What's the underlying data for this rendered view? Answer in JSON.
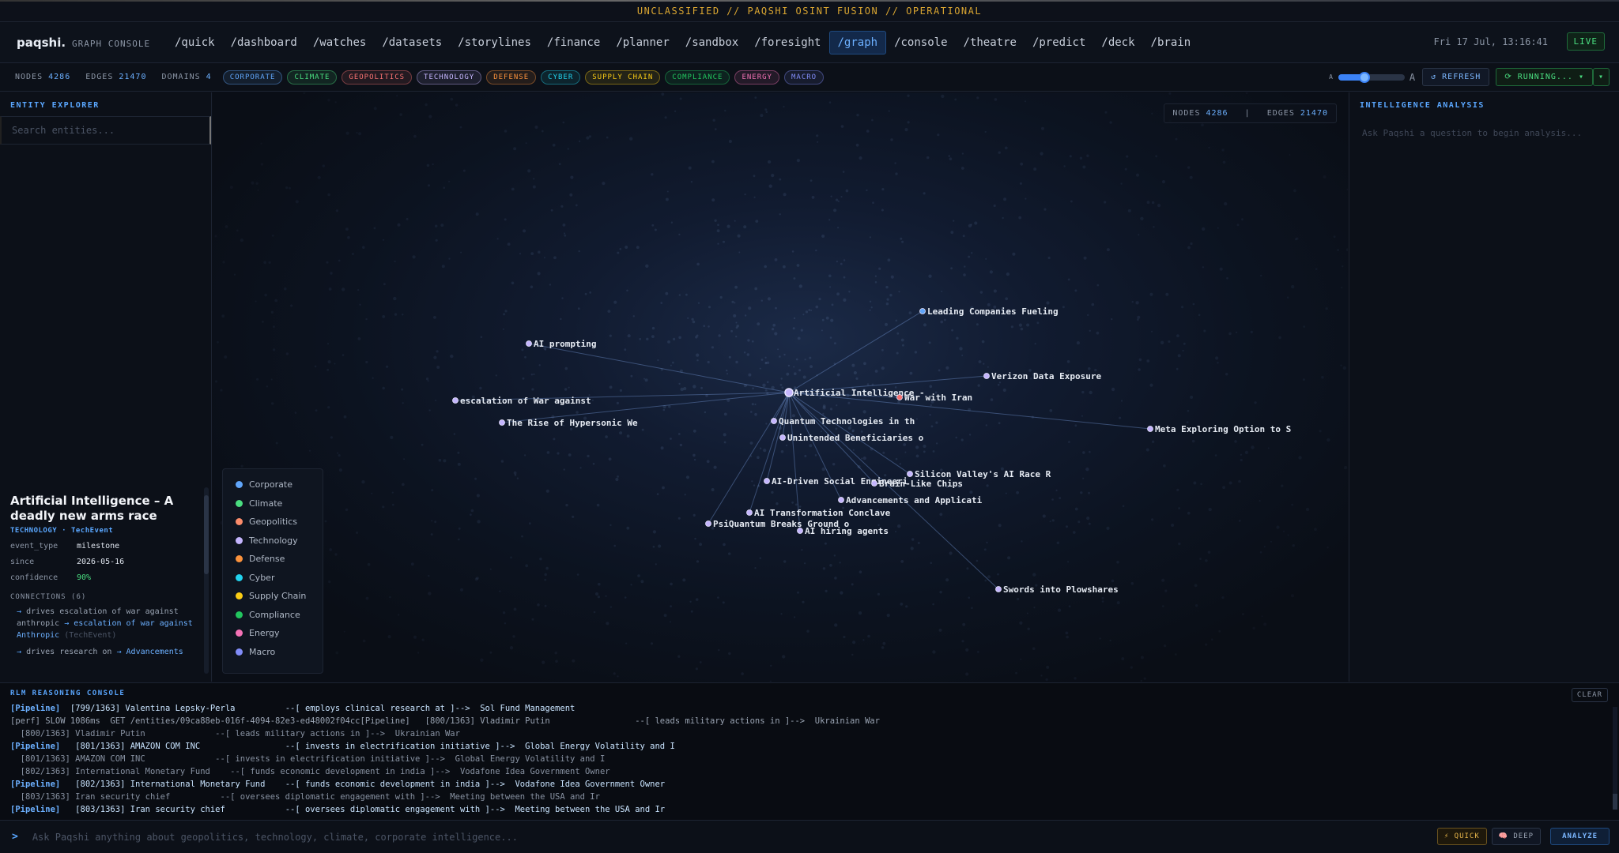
{
  "classification": "UNCLASSIFIED // PAQSHI OSINT FUSION // OPERATIONAL",
  "brand": {
    "logo": "paqshi.",
    "subtitle": "GRAPH CONSOLE"
  },
  "nav": [
    {
      "label": "/quick"
    },
    {
      "label": "/dashboard"
    },
    {
      "label": "/watches"
    },
    {
      "label": "/datasets"
    },
    {
      "label": "/storylines"
    },
    {
      "label": "/finance"
    },
    {
      "label": "/planner"
    },
    {
      "label": "/sandbox"
    },
    {
      "label": "/foresight"
    },
    {
      "label": "/graph",
      "active": true
    },
    {
      "label": "/console"
    },
    {
      "label": "/theatre"
    },
    {
      "label": "/predict"
    },
    {
      "label": "/deck"
    },
    {
      "label": "/brain"
    }
  ],
  "clock": "Fri 17 Jul, 13:16:41",
  "live": "LIVE",
  "stats": {
    "nodes_label": "NODES",
    "nodes": "4286",
    "edges_label": "EDGES",
    "edges": "21470",
    "domains_label": "DOMAINS",
    "domains": "4"
  },
  "chips": [
    {
      "label": "CORPORATE",
      "color": "#60a5fa"
    },
    {
      "label": "CLIMATE",
      "color": "#4ade80"
    },
    {
      "label": "GEOPOLITICS",
      "color": "#f87171"
    },
    {
      "label": "TECHNOLOGY",
      "color": "#c4b5fd"
    },
    {
      "label": "DEFENSE",
      "color": "#fb923c"
    },
    {
      "label": "CYBER",
      "color": "#22d3ee"
    },
    {
      "label": "SUPPLY CHAIN",
      "color": "#facc15"
    },
    {
      "label": "COMPLIANCE",
      "color": "#22c55e"
    },
    {
      "label": "ENERGY",
      "color": "#f472b6"
    },
    {
      "label": "MACRO",
      "color": "#818cf8"
    }
  ],
  "controls": {
    "font_small": "A",
    "font_large": "A",
    "font_scale": 0.4,
    "refresh": "↺ REFRESH",
    "running": "⟳ RUNNING... ▾",
    "caret": "▾"
  },
  "explorer": {
    "title": "ENTITY EXPLORER",
    "search_placeholder": "Search entities..."
  },
  "detail": {
    "title": "Artificial Intelligence – A deadly new arms race",
    "tags": "TECHNOLOGY · TechEvent",
    "fields": [
      {
        "k": "event_type",
        "v": "milestone"
      },
      {
        "k": "since",
        "v": "2026-05-16"
      },
      {
        "k": "confidence",
        "v": "90%"
      }
    ],
    "connections_label": "CONNECTIONS (6)",
    "connections": [
      {
        "arrow": "→",
        "text": "drives escalation of war against anthropic",
        "arrow2": "→",
        "target": "escalation of war against Anthropic",
        "type": "(TechEvent)"
      },
      {
        "arrow": "→",
        "text": "drives research on",
        "arrow2": "→",
        "target": "Advancements",
        "type": ""
      }
    ]
  },
  "graph": {
    "overlay": {
      "nodes_label": "NODES",
      "nodes": "4286",
      "edges_label": "EDGES",
      "edges": "21470"
    },
    "center": {
      "label": "Artificial Intelligence -"
    },
    "nodes": [
      {
        "label": "Leading Companies Fueling",
        "color": "#60a5fa"
      },
      {
        "label": "AI prompting",
        "color": "#c4b5fd"
      },
      {
        "label": "Verizon Data Exposure",
        "color": "#c4b5fd"
      },
      {
        "label": "War with Iran",
        "color": "#f87171"
      },
      {
        "label": "escalation of War against",
        "color": "#c4b5fd"
      },
      {
        "label": "The Rise of Hypersonic We",
        "color": "#c4b5fd"
      },
      {
        "label": "Quantum Technologies in th",
        "color": "#c4b5fd"
      },
      {
        "label": "Meta Exploring Option to S",
        "color": "#c4b5fd"
      },
      {
        "label": "Unintended Beneficiaries o",
        "color": "#c4b5fd"
      },
      {
        "label": "Silicon Valley's AI Race R",
        "color": "#c4b5fd"
      },
      {
        "label": "AI-Driven Social Engineeri",
        "color": "#c4b5fd"
      },
      {
        "label": "Brain-Like Chips",
        "color": "#c4b5fd"
      },
      {
        "label": "Advancements and Applicati",
        "color": "#c4b5fd"
      },
      {
        "label": "AI Transformation Conclave",
        "color": "#c4b5fd"
      },
      {
        "label": "PsiQuantum Breaks Ground o",
        "color": "#c4b5fd"
      },
      {
        "label": "AI hiring agents",
        "color": "#c4b5fd"
      },
      {
        "label": "Swords into Plowshares",
        "color": "#c4b5fd"
      }
    ]
  },
  "legend": [
    {
      "label": "Corporate",
      "color": "#60a5fa"
    },
    {
      "label": "Climate",
      "color": "#4ade80"
    },
    {
      "label": "Geopolitics",
      "color": "#fb8c6b"
    },
    {
      "label": "Technology",
      "color": "#c4b5fd"
    },
    {
      "label": "Defense",
      "color": "#fb923c"
    },
    {
      "label": "Cyber",
      "color": "#22d3ee"
    },
    {
      "label": "Supply Chain",
      "color": "#facc15"
    },
    {
      "label": "Compliance",
      "color": "#22c55e"
    },
    {
      "label": "Energy",
      "color": "#f472b6"
    },
    {
      "label": "Macro",
      "color": "#818cf8"
    }
  ],
  "analysis": {
    "title": "INTELLIGENCE ANALYSIS",
    "placeholder": "Ask Paqshi a question to begin analysis..."
  },
  "console": {
    "title": "RLM REASONING CONSOLE",
    "clear": "CLEAR",
    "lines": [
      {
        "kind": "hi",
        "pre": "[Pipeline]",
        "text": "  [799/1363] Valentina Lepsky-Perla          --[ employs clinical research at ]-->  Sol Fund Management"
      },
      {
        "kind": "perf",
        "text": "[perf] SLOW 1086ms  GET /entities/09ca88eb-016f-4094-82e3-ed48002f04cc[Pipeline]   [800/1363] Vladimir Putin                 --[ leads military actions in ]-->  Ukrainian War"
      },
      {
        "kind": "dim",
        "text": "  [800/1363] Vladimir Putin              --[ leads military actions in ]-->  Ukrainian War"
      },
      {
        "kind": "hi",
        "pre": "[Pipeline]",
        "text": "   [801/1363] AMAZON COM INC                 --[ invests in electrification initiative ]-->  Global Energy Volatility and I"
      },
      {
        "kind": "dim",
        "text": "  [801/1363] AMAZON COM INC              --[ invests in electrification initiative ]-->  Global Energy Volatility and I"
      },
      {
        "kind": "dim",
        "text": "  [802/1363] International Monetary Fund    --[ funds economic development in india ]-->  Vodafone Idea Government Owner"
      },
      {
        "kind": "hi",
        "pre": "[Pipeline]",
        "text": "   [802/1363] International Monetary Fund    --[ funds economic development in india ]-->  Vodafone Idea Government Owner"
      },
      {
        "kind": "dim",
        "text": "  [803/1363] Iran security chief          --[ oversees diplomatic engagement with ]-->  Meeting between the USA and Ir"
      },
      {
        "kind": "hi",
        "pre": "[Pipeline]",
        "text": "   [803/1363] Iran security chief            --[ oversees diplomatic engagement with ]-->  Meeting between the USA and Ir"
      }
    ]
  },
  "cmd": {
    "prompt": ">",
    "placeholder": "Ask Paqshi anything about geopolitics, technology, climate, corporate intelligence...",
    "quick": "⚡ QUICK",
    "deep": "🧠 DEEP",
    "analyze": "ANALYZE"
  }
}
